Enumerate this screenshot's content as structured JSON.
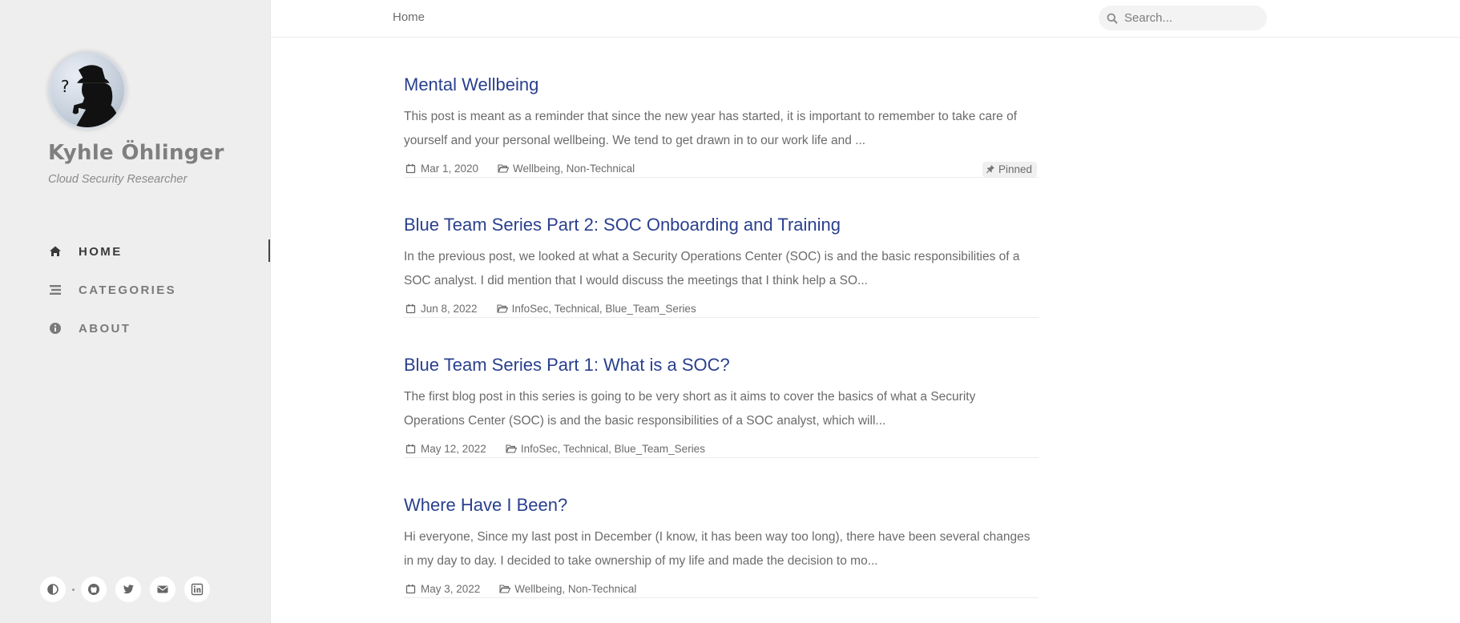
{
  "site": {
    "title": "Kyhle Öhlinger",
    "subtitle": "Cloud Security Researcher"
  },
  "nav": [
    {
      "label": "HOME",
      "icon": "home-icon",
      "active": true
    },
    {
      "label": "CATEGORIES",
      "icon": "list-icon",
      "active": false
    },
    {
      "label": "ABOUT",
      "icon": "info-icon",
      "active": false
    }
  ],
  "sidebar_bottom": {
    "icons": [
      "theme-toggle-icon",
      "github-icon",
      "twitter-icon",
      "email-icon",
      "linkedin-icon"
    ]
  },
  "topbar": {
    "breadcrumb": "Home",
    "search_placeholder": "Search..."
  },
  "posts": [
    {
      "title": "Mental Wellbeing",
      "excerpt": "This post is meant as a reminder that since the new year has started, it is important to remember to take care of yourself and your personal wellbeing. We tend to get drawn in to our work life and ...",
      "date": "Mar 1, 2020",
      "categories": "Wellbeing, Non-Technical",
      "badge": "Pinned"
    },
    {
      "title": "Blue Team Series Part 2: SOC Onboarding and Training",
      "excerpt": "In the previous post, we looked at what a Security Operations Center (SOC) is and the basic responsibilities of a SOC analyst. I did mention that I would discuss the meetings that I think help a SO...",
      "date": "Jun 8, 2022",
      "categories": "InfoSec, Technical, Blue_Team_Series"
    },
    {
      "title": "Blue Team Series Part 1: What is a SOC?",
      "excerpt": "The first blog post in this series is going to be very short as it aims to cover the basics of what a Security Operations Center (SOC) is and the basic responsibilities of a SOC analyst, which will...",
      "date": "May 12, 2022",
      "categories": "InfoSec, Technical, Blue_Team_Series"
    },
    {
      "title": "Where Have I Been?",
      "excerpt": "Hi everyone, Since my last post in December (I know, it has been way too long), there have been several changes in my day to day. I decided to take ownership of my life and made the decision to mo...",
      "date": "May 3, 2022",
      "categories": "Wellbeing, Non-Technical"
    }
  ],
  "colors": {
    "link": "#2a408e",
    "sidebar_bg": "#eeeeee",
    "text": "#6b6b6b"
  }
}
